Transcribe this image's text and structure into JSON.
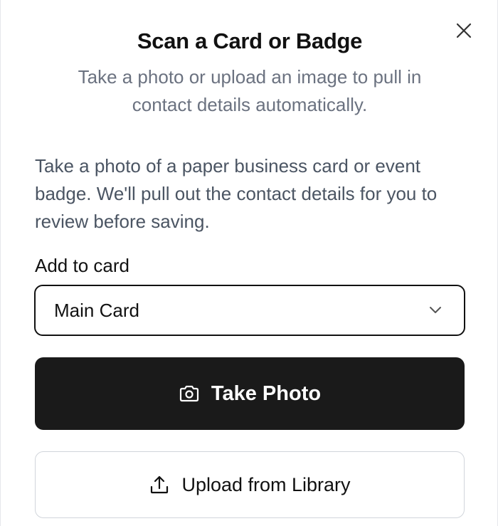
{
  "dialog": {
    "title": "Scan a Card or Badge",
    "subtitle": "Take a photo or upload an image to pull in contact details automatically.",
    "description": "Take a photo of a paper business card or event badge. We'll pull out the contact details for you to review before saving."
  },
  "form": {
    "card_label": "Add to card",
    "card_selected": "Main Card"
  },
  "actions": {
    "take_photo_label": "Take Photo",
    "upload_label": "Upload from Library"
  },
  "icons": {
    "close": "close-icon",
    "chevron": "chevron-down-icon",
    "camera": "camera-icon",
    "upload": "upload-icon"
  },
  "colors": {
    "primary_button": "#1a1a1a",
    "text": "#111111",
    "muted": "#6b7280",
    "body_text": "#4b5563"
  }
}
